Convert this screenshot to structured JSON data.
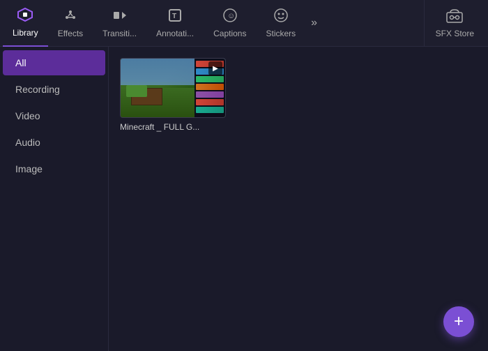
{
  "nav": {
    "items": [
      {
        "id": "library",
        "label": "Library",
        "icon": "📚",
        "active": true
      },
      {
        "id": "effects",
        "label": "Effects",
        "icon": "✨",
        "active": false
      },
      {
        "id": "transitions",
        "label": "Transiti...",
        "icon": "⏭",
        "active": false
      },
      {
        "id": "annotations",
        "label": "Annotati...",
        "icon": "📝",
        "active": false
      },
      {
        "id": "captions",
        "label": "Captions",
        "icon": "😊",
        "active": false
      },
      {
        "id": "stickers",
        "label": "Stickers",
        "icon": "😀",
        "active": false
      }
    ],
    "more_icon": "»",
    "sfx": {
      "label": "SFX Store",
      "icon": "🎭"
    }
  },
  "sidebar": {
    "items": [
      {
        "id": "all",
        "label": "All",
        "active": true
      },
      {
        "id": "recording",
        "label": "Recording",
        "active": false
      },
      {
        "id": "video",
        "label": "Video",
        "active": false
      },
      {
        "id": "audio",
        "label": "Audio",
        "active": false
      },
      {
        "id": "image",
        "label": "Image",
        "active": false
      }
    ]
  },
  "content": {
    "media_items": [
      {
        "id": "minecraft",
        "title": "Minecraft _ FULL G...",
        "type": "video"
      }
    ]
  },
  "fab": {
    "label": "+"
  }
}
